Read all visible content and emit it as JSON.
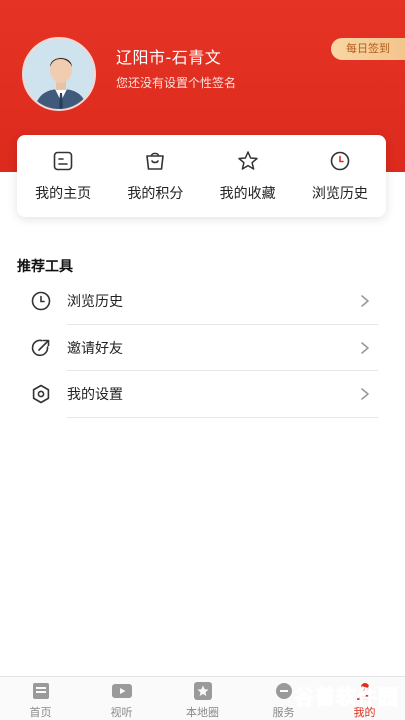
{
  "profile": {
    "username": "辽阳市-石青文",
    "signature": "您还没有设置个性签名",
    "checkin_label": "每日签到"
  },
  "quick_actions": [
    {
      "label": "我的主页",
      "icon": "homepage-icon"
    },
    {
      "label": "我的积分",
      "icon": "points-bag-icon"
    },
    {
      "label": "我的收藏",
      "icon": "star-icon"
    },
    {
      "label": "浏览历史",
      "icon": "clock-icon"
    }
  ],
  "tools": {
    "title": "推荐工具",
    "items": [
      {
        "label": "浏览历史",
        "icon": "clock-icon"
      },
      {
        "label": "邀请好友",
        "icon": "share-icon"
      },
      {
        "label": "我的设置",
        "icon": "settings-icon"
      }
    ]
  },
  "tabbar": {
    "tabs": [
      {
        "label": "首页",
        "icon": "news-icon"
      },
      {
        "label": "视听",
        "icon": "video-icon"
      },
      {
        "label": "本地圈",
        "icon": "star-badge-icon"
      },
      {
        "label": "服务",
        "icon": "service-icon"
      },
      {
        "label": "我的",
        "icon": "profile-icon",
        "active": true
      }
    ]
  },
  "watermark": "谷普软件园",
  "colors": {
    "brand_red": "#e53325",
    "active_tab": "#e02e20",
    "checkin_bg": "#f8d6a4"
  }
}
